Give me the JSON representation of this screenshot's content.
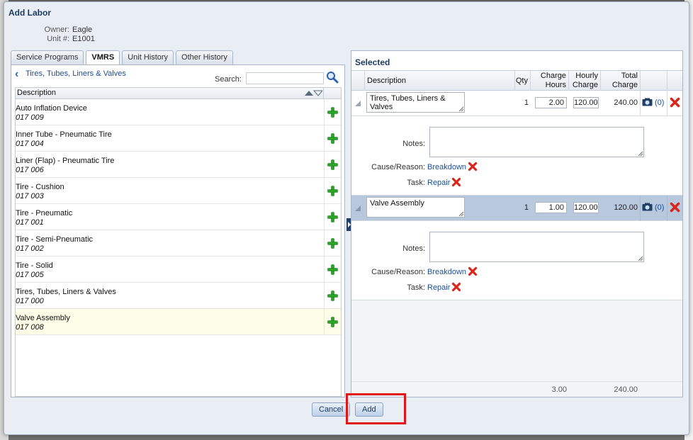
{
  "dialog": {
    "title": "Add Labor"
  },
  "meta": {
    "owner_label": "Owner:",
    "owner": "Eagle",
    "unit_label": "Unit #:",
    "unit": "E1001"
  },
  "tabs": [
    {
      "label": "Service Programs",
      "active": false
    },
    {
      "label": "VMRS",
      "active": true
    },
    {
      "label": "Unit History",
      "active": false
    },
    {
      "label": "Other History",
      "active": false
    }
  ],
  "browser": {
    "breadcrumb": "Tires, Tubes, Liners & Valves",
    "search_label": "Search:",
    "search_value": "",
    "column_header": "Description",
    "items": [
      {
        "name": "Auto Inflation Device",
        "code": "017 009"
      },
      {
        "name": "Inner Tube - Pneumatic Tire",
        "code": "017 004"
      },
      {
        "name": "Liner (Flap) - Pneumatic Tire",
        "code": "017 006"
      },
      {
        "name": "Tire - Cushion",
        "code": "017 003"
      },
      {
        "name": "Tire - Pneumatic",
        "code": "017 001"
      },
      {
        "name": "Tire - Semi-Pneumatic",
        "code": "017 002"
      },
      {
        "name": "Tire - Solid",
        "code": "017 005"
      },
      {
        "name": "Tires, Tubes, Liners & Valves",
        "code": "017 000"
      },
      {
        "name": "Valve Assembly",
        "code": "017 008"
      }
    ]
  },
  "selected": {
    "title": "Selected",
    "headers": {
      "description": "Description",
      "qty": "Qty",
      "charge_hours_1": "Charge",
      "charge_hours_2": "Hours",
      "hourly_charge_1": "Hourly",
      "hourly_charge_2": "Charge",
      "total_charge_1": "Total",
      "total_charge_2": "Charge"
    },
    "lines": [
      {
        "description": "Tires, Tubes, Liners & Valves",
        "qty": "1",
        "charge_hours": "2.00",
        "hourly_charge": "120.00",
        "total": "240.00",
        "attachments": "(0)",
        "notes_label": "Notes:",
        "notes": "",
        "cause_label": "Cause/Reason:",
        "cause": "Breakdown",
        "task_label": "Task:",
        "task": "Repair"
      },
      {
        "description": "Valve Assembly",
        "qty": "1",
        "charge_hours": "1.00",
        "hourly_charge": "120.00",
        "total": "120.00",
        "attachments": "(0)",
        "notes_label": "Notes:",
        "notes": "",
        "cause_label": "Cause/Reason:",
        "cause": "Breakdown",
        "task_label": "Task:",
        "task": "Repair"
      }
    ],
    "totals": {
      "charge_hours": "3.00",
      "total_charge": "240.00"
    }
  },
  "buttons": {
    "cancel": "Cancel",
    "add": "Add"
  },
  "colors": {
    "accent": "#1b4f94",
    "highlight": "#e0161b",
    "selected_row": "#b8c8dd",
    "add_icon": "#2aa52a",
    "delete_icon": "#d8261c"
  }
}
